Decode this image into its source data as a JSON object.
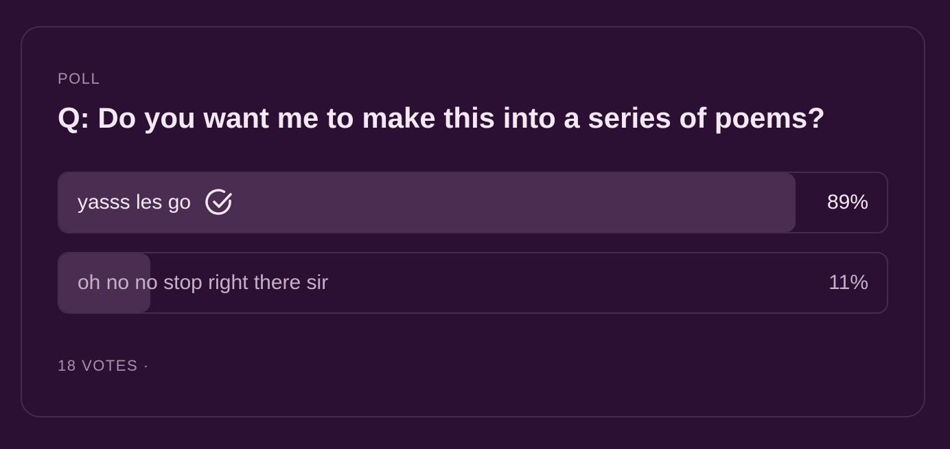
{
  "poll": {
    "label": "POLL",
    "question": "Q: Do you want me to make this into a series of poems?",
    "options": [
      {
        "text": "yasss les go",
        "percent_label": "89%",
        "share": 0.89,
        "selected": true,
        "icon": "check-circle-icon"
      },
      {
        "text": "oh no no stop right there sir",
        "percent_label": "11%",
        "share": 0.11,
        "selected": false
      }
    ],
    "votes": "18 VOTES ·"
  },
  "colors": {
    "background": "#2c1033",
    "border": "#452a4d",
    "fill": "#4a2d50",
    "text_primary": "#f3e8f3",
    "text_muted": "#a592a9"
  }
}
